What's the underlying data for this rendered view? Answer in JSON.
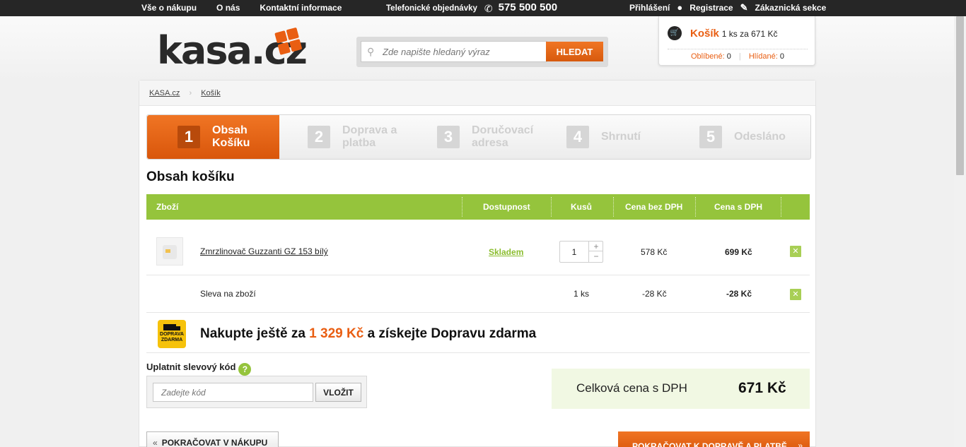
{
  "topbar": {
    "links": [
      "Vše o nákupu",
      "O nás",
      "Kontaktní informace"
    ],
    "phone_label": "Telefonické objednávky",
    "phone_number": "575 500 500",
    "login": "Přihlášení",
    "register": "Registrace",
    "customer": "Zákaznická sekce"
  },
  "header": {
    "logo": "kasa.cz",
    "search_placeholder": "Zde napište hledaný výraz",
    "search_button": "HLEDAT"
  },
  "cart": {
    "title": "Košík",
    "summary": "1 ks za 671 Kč",
    "favorites_label": "Oblíbené:",
    "favorites_count": "0",
    "watched_label": "Hlídané:",
    "watched_count": "0"
  },
  "breadcrumb": [
    "KASA.cz",
    "Košík"
  ],
  "steps": [
    {
      "num": "1",
      "label1": "Obsah",
      "label2": "Košíku"
    },
    {
      "num": "2",
      "label1": "Doprava a",
      "label2": "platba"
    },
    {
      "num": "3",
      "label1": "Doručovací",
      "label2": "adresa"
    },
    {
      "num": "4",
      "label1": "Shrnutí",
      "label2": ""
    },
    {
      "num": "5",
      "label1": "Odesláno",
      "label2": ""
    }
  ],
  "page_title": "Obsah košíku",
  "table": {
    "headers": [
      "Zboží",
      "Dostupnost",
      "Kusů",
      "Cena bez DPH",
      "Cena s DPH"
    ],
    "item": {
      "name": "Zmrzlinovač Guzzanti GZ 153 bílý",
      "availability": "Skladem",
      "qty": "1",
      "price_net": "578 Kč",
      "price_gross": "699 Kč"
    },
    "discount": {
      "name": "Sleva na zboží",
      "qty": "1 ks",
      "price_net": "-28 Kč",
      "price_gross": "-28 Kč"
    }
  },
  "shipping": {
    "icon_line1": "DOPRAVA",
    "icon_line2": "ZDARMA",
    "text_before": "Nakupte ještě za ",
    "amount": "1 329 Kč",
    "text_after": " a získejte Dopravu zdarma"
  },
  "coupon": {
    "label": "Uplatnit slevový kód",
    "help": "?",
    "placeholder": "Zadejte kód",
    "button": "VLOŽIT"
  },
  "total": {
    "label": "Celková cena s DPH",
    "value": "671 Kč"
  },
  "buttons": {
    "back": "POKRAČOVAT V NÁKUPU",
    "next": "POKRAČOVAT K DOPRAVĚ A PLATBĚ"
  }
}
